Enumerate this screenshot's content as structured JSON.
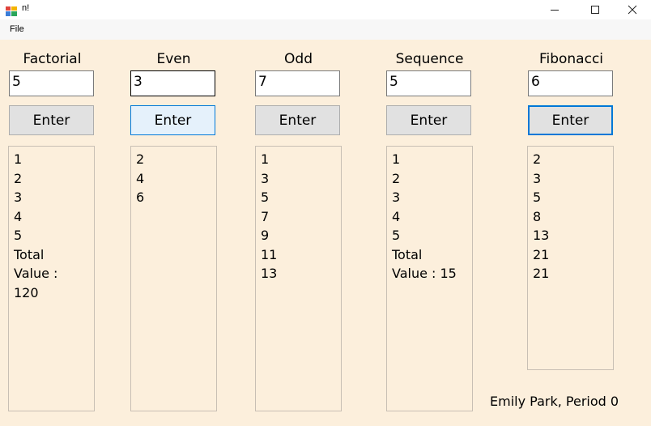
{
  "window": {
    "title": "n!"
  },
  "menu": {
    "file_label": "File"
  },
  "columns": [
    {
      "label": "Factorial",
      "input_value": "5",
      "button_label": "Enter",
      "items": [
        "1",
        "2",
        "3",
        "4",
        "5",
        "Total",
        "Value :",
        "120"
      ]
    },
    {
      "label": "Even",
      "input_value": "3",
      "button_label": "Enter",
      "items": [
        "2",
        "4",
        "6"
      ]
    },
    {
      "label": "Odd",
      "input_value": "7",
      "button_label": "Enter",
      "items": [
        "1",
        "3",
        "5",
        "7",
        "9",
        "11",
        "13"
      ]
    },
    {
      "label": "Sequence",
      "input_value": "5",
      "button_label": "Enter",
      "items": [
        "1",
        "2",
        "3",
        "4",
        "5",
        "Total",
        "Value : 15"
      ]
    },
    {
      "label": "Fibonacci",
      "input_value": "6",
      "button_label": "Enter",
      "items": [
        "2",
        "3",
        "5",
        "8",
        "13",
        "21",
        "21"
      ]
    }
  ],
  "footer": {
    "credit": "Emily Park, Period 0"
  },
  "colors": {
    "client_background": "#fcefdc",
    "focus_accent": "#0078d7"
  }
}
